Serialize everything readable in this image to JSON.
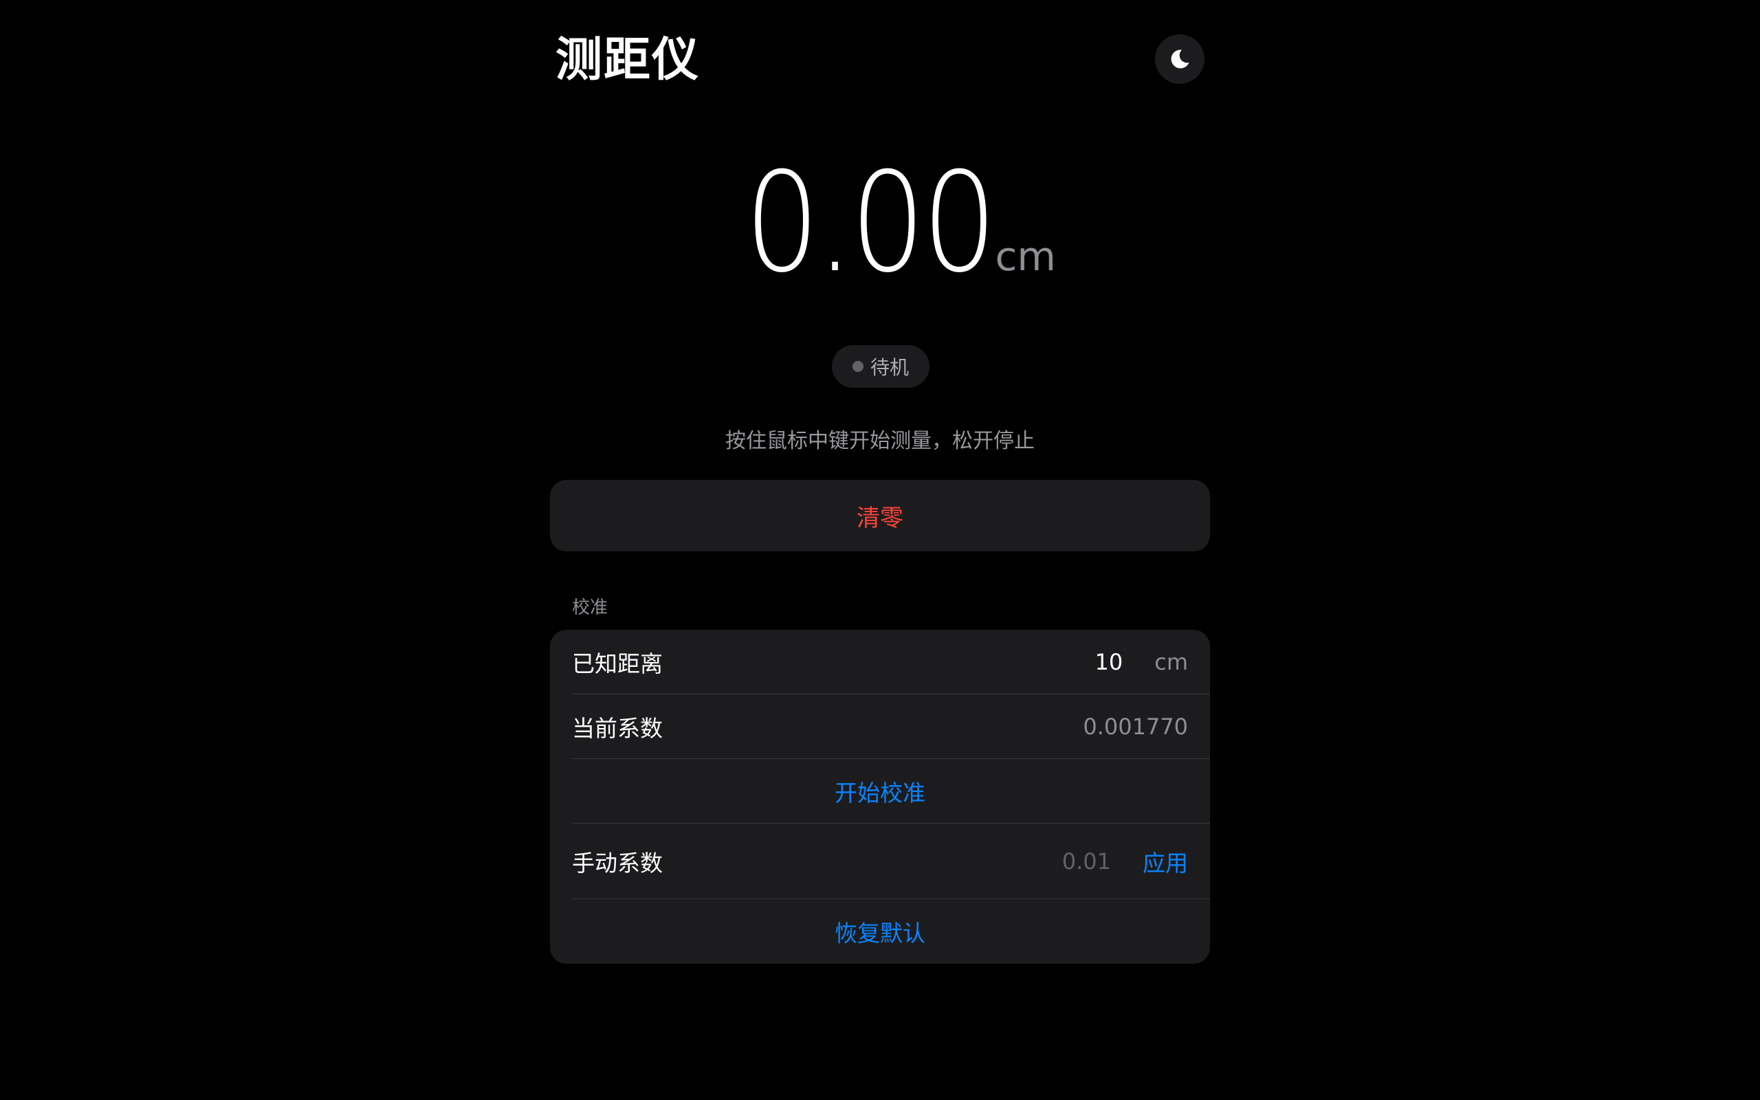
{
  "app": {
    "title": "测距仪"
  },
  "header": {
    "theme_toggle_icon": "moon-icon"
  },
  "reading": {
    "value": "0.00",
    "unit": "cm"
  },
  "status": {
    "text": "待机",
    "dot_color": "#636366"
  },
  "hint": "按住鼠标中键开始测量，松开停止",
  "clear_button": {
    "label": "清零",
    "color": "#ff453a"
  },
  "calibration": {
    "section_label": "校准",
    "known_distance": {
      "label": "已知距离",
      "value": "10",
      "unit": "cm"
    },
    "current_factor": {
      "label": "当前系数",
      "value": "0.001770"
    },
    "start_calibration_label": "开始校准",
    "manual_factor": {
      "label": "手动系数",
      "placeholder": "0.01",
      "apply_label": "应用"
    },
    "restore_default_label": "恢复默认"
  },
  "colors": {
    "background": "#000000",
    "card": "#1c1c1e",
    "accent": "#0a84ff",
    "destructive": "#ff453a",
    "secondary_text": "#8e8e93"
  }
}
